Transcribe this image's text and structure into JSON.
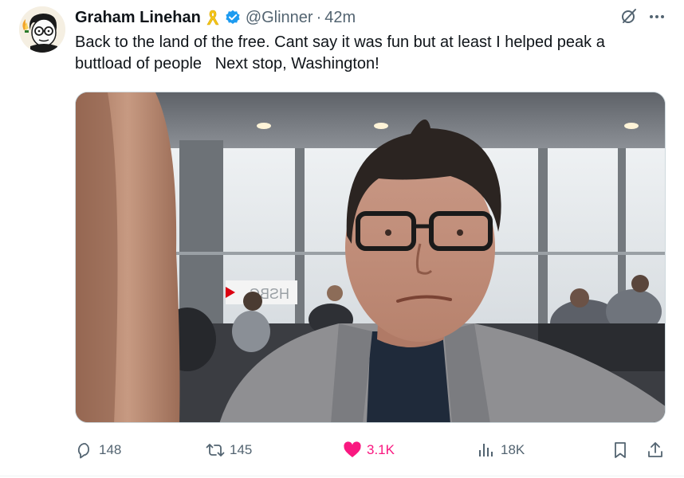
{
  "author": {
    "name": "Graham Linehan",
    "handle": "@Glinner",
    "separator": "·",
    "time": "42m",
    "badges": [
      "yellow-ribbon-icon",
      "verified-badge-icon"
    ],
    "avatar": "cartoon-avatar"
  },
  "tweet": {
    "text": "Back to the land of the free. Cant say it was fun but at least I helped peak a buttload of people   Next stop, Washington!"
  },
  "media": {
    "type": "photo",
    "description_icon": "airport-selfie-photo",
    "sign_text": "HSBC"
  },
  "actions": {
    "replies": "148",
    "reposts": "145",
    "likes": "3.1K",
    "views": "18K"
  },
  "colors": {
    "text": "#0f1419",
    "muted": "#536471",
    "verified": "#1d9bf0",
    "like": "#f91880",
    "ribbon": "#f5c518"
  },
  "icons": [
    "grok-icon",
    "more-icon",
    "reply-icon",
    "repost-icon",
    "like-icon",
    "views-icon",
    "bookmark-icon",
    "share-icon"
  ]
}
